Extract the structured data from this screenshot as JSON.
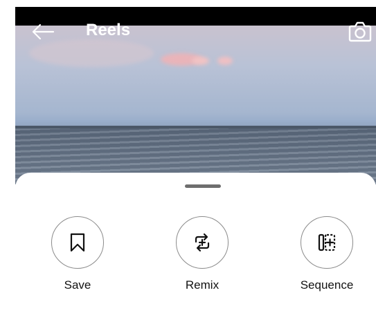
{
  "header": {
    "title": "Reels",
    "back_icon": "arrow-left-icon",
    "camera_icon": "camera-icon"
  },
  "sheet": {
    "actions": [
      {
        "label": "Save",
        "icon": "bookmark-icon"
      },
      {
        "label": "Remix",
        "icon": "remix-icon"
      },
      {
        "label": "Sequence",
        "icon": "sequence-icon"
      }
    ]
  },
  "colors": {
    "sheet_background": "#ffffff",
    "icon_stroke": "#111111",
    "circle_border": "#8a8a8a",
    "status_bar": "#000000"
  }
}
